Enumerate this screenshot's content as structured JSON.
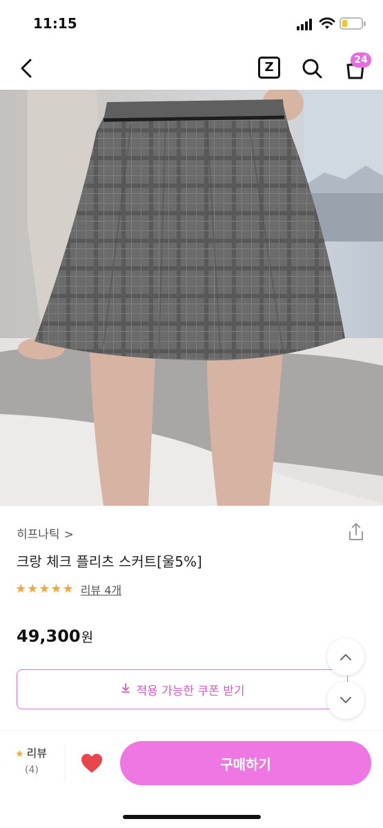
{
  "status_bar": {
    "time": "11:15"
  },
  "nav": {
    "z_label": "Z",
    "cart_count": "24",
    "icons": [
      "back-arrow-icon",
      "zigzag-z-icon",
      "search-icon",
      "shopping-bag-icon"
    ]
  },
  "product": {
    "brand": "히프나틱",
    "brand_chevron": ">",
    "title": "크랑 체크 플리츠 스커트[울5%]",
    "rating_stars": 5,
    "review_link": "리뷰 4개",
    "price": "49,300",
    "price_unit": "원",
    "coupon_label": "적용 가능한 쿠폰 받기"
  },
  "bottom_bar": {
    "review_label": "리뷰",
    "review_count": "(4)",
    "buy_label": "구매하기"
  },
  "colors": {
    "accent": "#ee77e4",
    "badge": "#e86be0",
    "star": "#f3a73b",
    "heart": "#e8464c"
  }
}
